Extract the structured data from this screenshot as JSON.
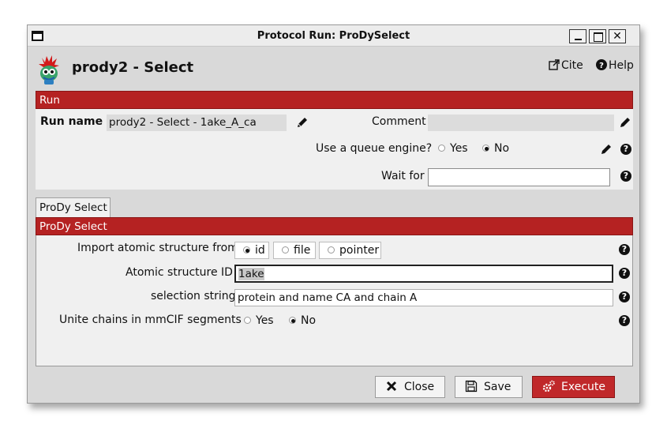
{
  "window": {
    "title": "Protocol Run: ProDySelect",
    "controls": {
      "minimize": "_",
      "maximize": "□",
      "close": "✕"
    }
  },
  "header": {
    "title": "prody2 - Select",
    "cite_label": "Cite",
    "help_label": "Help"
  },
  "run_section": {
    "title": "Run",
    "run_name_label": "Run name",
    "run_name_value": "prody2 - Select - 1ake_A_ca",
    "comment_label": "Comment",
    "comment_value": "",
    "queue_label": "Use a queue engine?",
    "queue_options": [
      "Yes",
      "No"
    ],
    "queue_selected": "No",
    "wait_for_label": "Wait for",
    "wait_for_value": ""
  },
  "tabs": [
    "ProDy Select"
  ],
  "form": {
    "section_title": "ProDy Select",
    "import_label": "Import atomic structure from",
    "import_options": [
      "id",
      "file",
      "pointer"
    ],
    "import_selected": "id",
    "structure_id_label": "Atomic structure ID",
    "structure_id_value": "1ake",
    "selection_label": "selection string",
    "selection_value": "protein and name CA and chain A",
    "unite_label": "Unite chains in mmCIF segments",
    "unite_options": [
      "Yes",
      "No"
    ],
    "unite_selected": "No"
  },
  "buttons": {
    "close": "Close",
    "save": "Save",
    "execute": "Execute"
  },
  "colors": {
    "accent": "#b52222",
    "panel": "#f0f0f0",
    "window": "#d9d9d9"
  }
}
